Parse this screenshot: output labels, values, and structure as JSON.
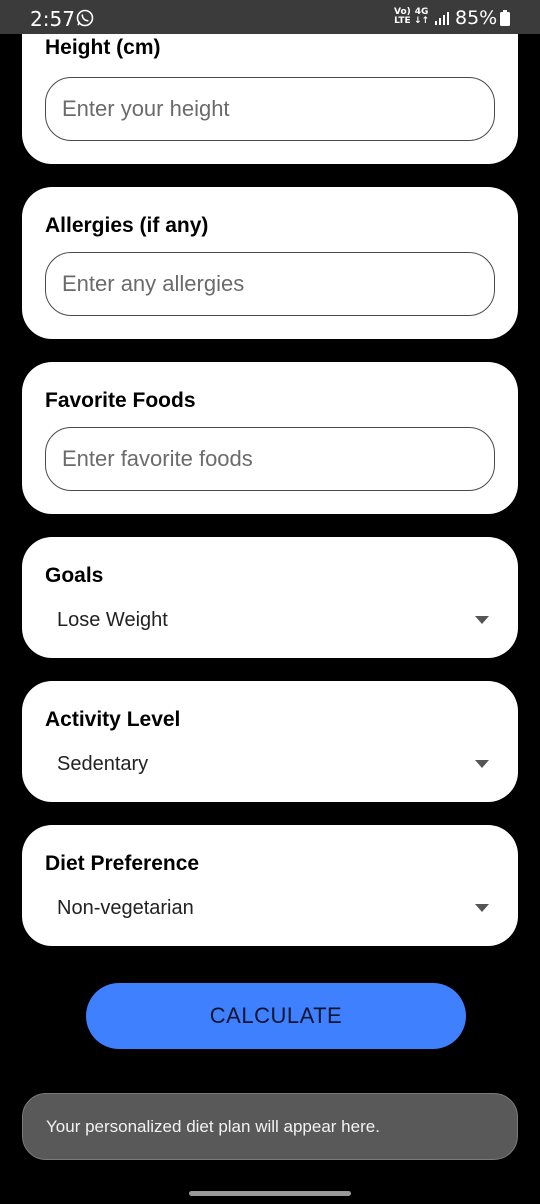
{
  "status_bar": {
    "time": "2:57",
    "volte_top": "Vo)",
    "volte_bottom": "LTE",
    "network_top": "4G",
    "network_bottom": "↓↑",
    "battery": "85%"
  },
  "form": {
    "height": {
      "label": "Height (cm)",
      "placeholder": "Enter your height"
    },
    "allergies": {
      "label": "Allergies (if any)",
      "placeholder": "Enter any allergies"
    },
    "favorite_foods": {
      "label": "Favorite Foods",
      "placeholder": "Enter favorite foods"
    },
    "goals": {
      "label": "Goals",
      "value": "Lose Weight"
    },
    "activity_level": {
      "label": "Activity Level",
      "value": "Sedentary"
    },
    "diet_preference": {
      "label": "Diet Preference",
      "value": "Non-vegetarian"
    }
  },
  "calculate_button": "CALCULATE",
  "result": "Your personalized diet plan will appear here.",
  "colors": {
    "accent": "#3f80ff",
    "background": "#000000",
    "card": "#ffffff",
    "result_box": "#595959"
  }
}
